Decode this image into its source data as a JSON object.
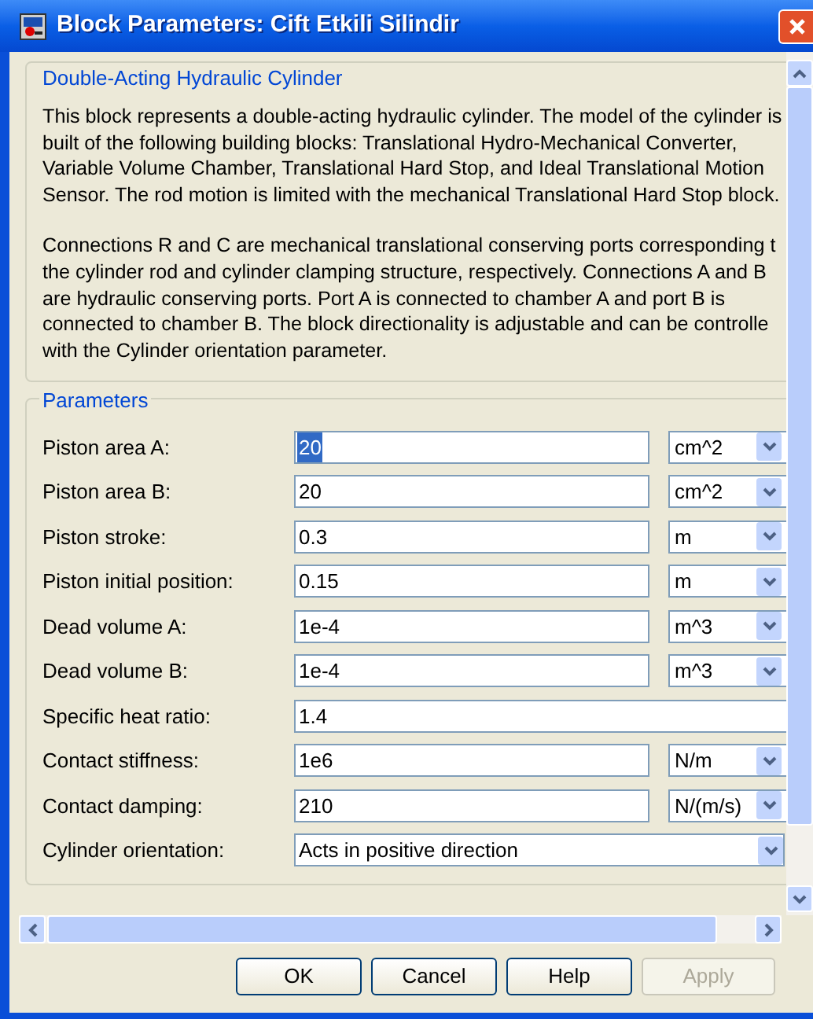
{
  "window": {
    "title": "Block Parameters: Cift Etkili Silindir"
  },
  "description": {
    "legend": "Double-Acting Hydraulic Cylinder",
    "paragraphs": [
      [
        "This block represents a double-acting hydraulic cylinder. The model of the cylinder is",
        "built of the following building blocks: Translational Hydro-Mechanical Converter,",
        "Variable Volume Chamber, Translational Hard Stop, and Ideal Translational Motion",
        "Sensor. The rod motion is limited with the mechanical Translational Hard Stop block."
      ],
      [
        "Connections R and C are mechanical translational conserving ports corresponding t",
        "the cylinder rod and cylinder clamping structure, respectively. Connections A and B",
        "are hydraulic conserving ports. Port A is connected to chamber A and port B is",
        "connected to chamber B. The block directionality is adjustable and can be controlle",
        "with the Cylinder orientation parameter."
      ]
    ]
  },
  "parameters": {
    "legend": "Parameters",
    "rows": [
      {
        "kind": "edit_unit",
        "label": "Piston area A:",
        "value": "20",
        "text_selected": true,
        "unit": "cm^2"
      },
      {
        "kind": "edit_unit",
        "label": "Piston area B:",
        "value": "20",
        "text_selected": false,
        "unit": "cm^2"
      },
      {
        "kind": "edit_unit",
        "label": "Piston stroke:",
        "value": "0.3",
        "text_selected": false,
        "unit": "m"
      },
      {
        "kind": "edit_unit",
        "label": "Piston initial position:",
        "value": "0.15",
        "text_selected": false,
        "unit": "m"
      },
      {
        "kind": "edit_unit",
        "label": "Dead volume A:",
        "value": "1e-4",
        "text_selected": false,
        "unit": "m^3"
      },
      {
        "kind": "edit_unit",
        "label": "Dead volume B:",
        "value": "1e-4",
        "text_selected": false,
        "unit": "m^3"
      },
      {
        "kind": "edit",
        "label": "Specific heat ratio:",
        "value": "1.4",
        "text_selected": false
      },
      {
        "kind": "edit_unit",
        "label": "Contact stiffness:",
        "value": "1e6",
        "text_selected": false,
        "unit": "N/m"
      },
      {
        "kind": "edit_unit",
        "label": "Contact damping:",
        "value": "210",
        "text_selected": false,
        "unit": "N/(m/s)"
      },
      {
        "kind": "popup",
        "label": "Cylinder orientation:",
        "value": "Acts in positive direction"
      }
    ]
  },
  "buttons": [
    {
      "label": "OK",
      "disabled": false
    },
    {
      "label": "Cancel",
      "disabled": false
    },
    {
      "label": "Help",
      "disabled": false
    },
    {
      "label": "Apply",
      "disabled": true
    }
  ]
}
